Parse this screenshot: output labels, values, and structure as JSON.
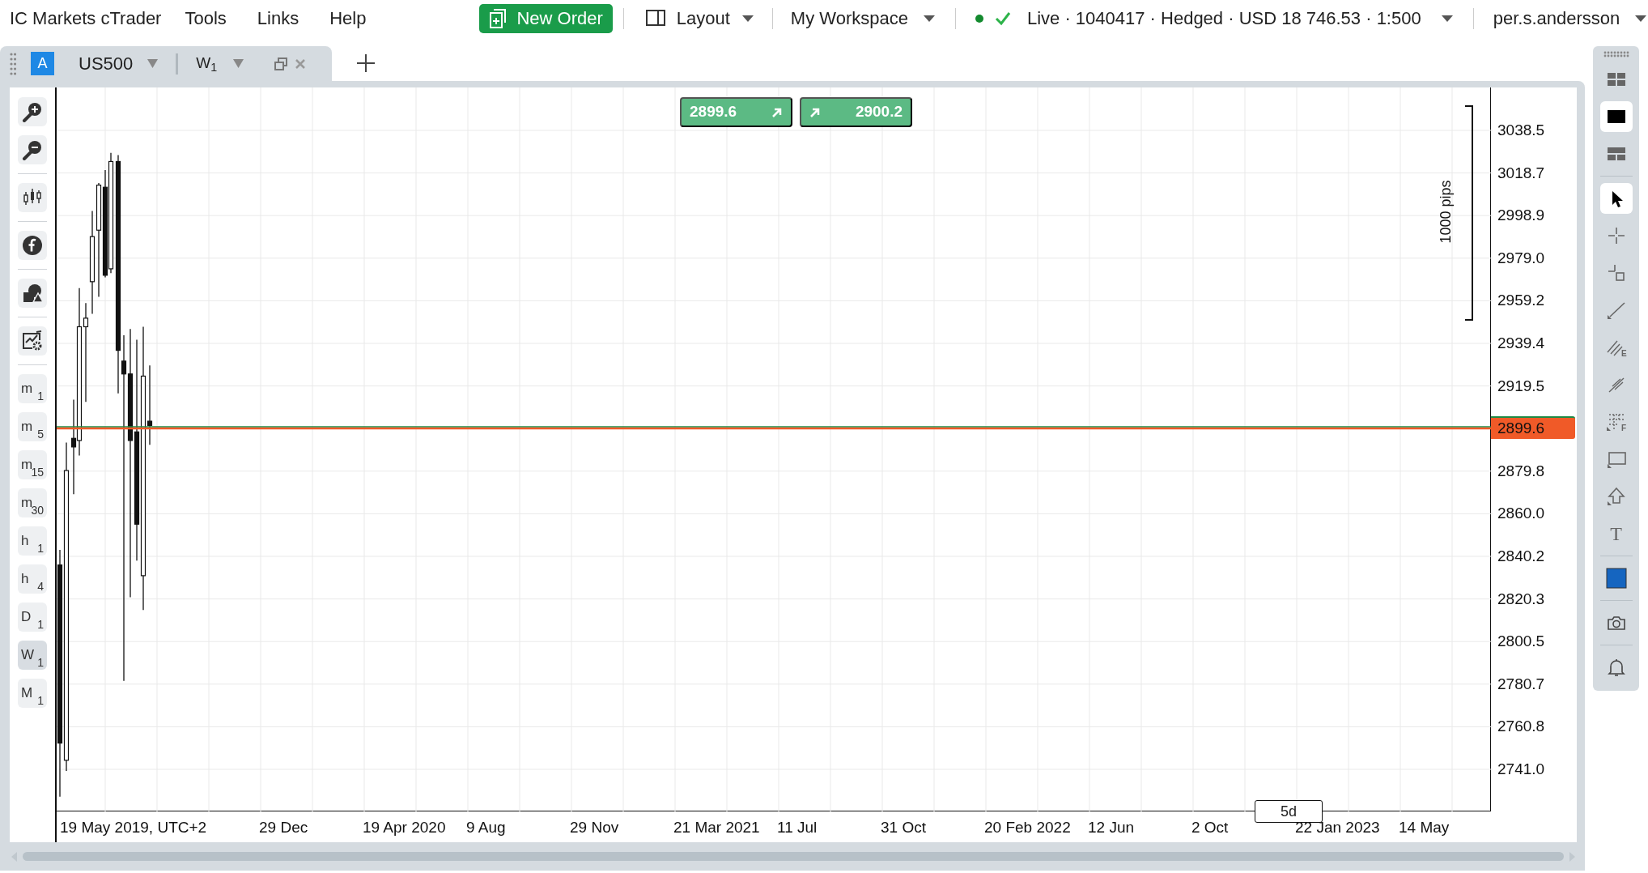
{
  "menubar": {
    "brand": "IC Markets cTrader",
    "menus": [
      "Tools",
      "Links",
      "Help"
    ]
  },
  "toolbar": {
    "new_order": "New Order",
    "layout": "Layout",
    "workspace": "My Workspace",
    "connected": true,
    "account": "Live · 1040417 · Hedged · USD 18 746.53 · 1:500",
    "user": "per.s.andersson"
  },
  "chart_tab": {
    "badge": "A",
    "symbol": "US500",
    "timeframe": "W$_{1}$"
  },
  "timeframes": [
    {
      "label": "m$_{1}$",
      "selected": false
    },
    {
      "label": "m$_{5}$",
      "selected": false
    },
    {
      "label": "m$_{15}$",
      "selected": false
    },
    {
      "label": "m$_{30}$",
      "selected": false
    },
    {
      "label": "h$_{1}$",
      "selected": false
    },
    {
      "label": "h$_{4}$",
      "selected": false
    },
    {
      "label": "D$_{1}$",
      "selected": false
    },
    {
      "label": "W$_{1}$",
      "selected": true
    },
    {
      "label": "M$_{1}$",
      "selected": false
    }
  ],
  "chart": {
    "bid": "2899.6",
    "ask": "2900.2",
    "ruler": "1000 pips",
    "period_marker": "5d",
    "price_labels": [
      {
        "text": "3038.5",
        "current": false
      },
      {
        "text": "3018.7",
        "current": false
      },
      {
        "text": "2998.9",
        "current": false
      },
      {
        "text": "2979.0",
        "current": false
      },
      {
        "text": "2959.2",
        "current": false
      },
      {
        "text": "2939.4",
        "current": false
      },
      {
        "text": "2919.5",
        "current": false
      },
      {
        "text": "2899.6",
        "current": true
      },
      {
        "text": "2879.8",
        "current": false
      },
      {
        "text": "2860.0",
        "current": false
      },
      {
        "text": "2840.2",
        "current": false
      },
      {
        "text": "2820.3",
        "current": false
      },
      {
        "text": "2800.5",
        "current": false
      },
      {
        "text": "2780.7",
        "current": false
      },
      {
        "text": "2760.8",
        "current": false
      },
      {
        "text": "2741.0",
        "current": false
      }
    ],
    "date_labels": [
      "19 May 2019, UTC+2",
      "29 Dec",
      "19 Apr 2020",
      "9 Aug",
      "29 Nov",
      "21 Mar 2021",
      "11 Jul",
      "31 Oct",
      "20 Feb 2022",
      "12 Jun",
      "2 Oct",
      "22 Jan 2023",
      "14 May"
    ]
  },
  "layout_views": [
    {
      "kind": "grid",
      "selected": false
    },
    {
      "kind": "single",
      "selected": true
    },
    {
      "kind": "rows",
      "selected": false
    }
  ],
  "drawing_tools": [
    {
      "kind": "pointer",
      "selected": true
    },
    {
      "kind": "crosshair",
      "selected": false
    },
    {
      "kind": "crosshair-box",
      "selected": false
    },
    {
      "kind": "line",
      "selected": false
    },
    {
      "kind": "fib-e",
      "label": "E",
      "selected": false
    },
    {
      "kind": "pitchfork",
      "selected": false
    },
    {
      "kind": "fib-grid",
      "label": "F",
      "selected": false
    },
    {
      "kind": "rectangle",
      "selected": false
    },
    {
      "kind": "arrow",
      "selected": false
    },
    {
      "kind": "text",
      "label": "T",
      "selected": false
    }
  ],
  "color_tool": {
    "color": "#1565c0"
  }
}
